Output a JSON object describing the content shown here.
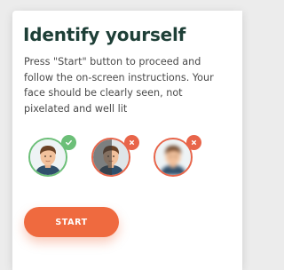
{
  "dialog": {
    "title": "Identify yourself",
    "instructions": "Press \"Start\" button to proceed and follow the on-screen instructions. Your face should be clearly seen, not pixelated and well lit"
  },
  "examples": [
    {
      "status": "correct",
      "badge_icon": "checkmark-icon",
      "badge_color": "#6cbf78"
    },
    {
      "status": "incorrect",
      "issue": "poorly lit",
      "badge_icon": "close-icon",
      "badge_color": "#e8654a"
    },
    {
      "status": "incorrect",
      "issue": "blurred",
      "badge_icon": "close-icon",
      "badge_color": "#e8654a"
    }
  ],
  "actions": {
    "start_label": "START",
    "start_color": "#ef6a3f"
  },
  "colors": {
    "title": "#1e3f37",
    "text": "#4a4a4a",
    "good": "#6cbf78",
    "bad": "#e8654a"
  }
}
